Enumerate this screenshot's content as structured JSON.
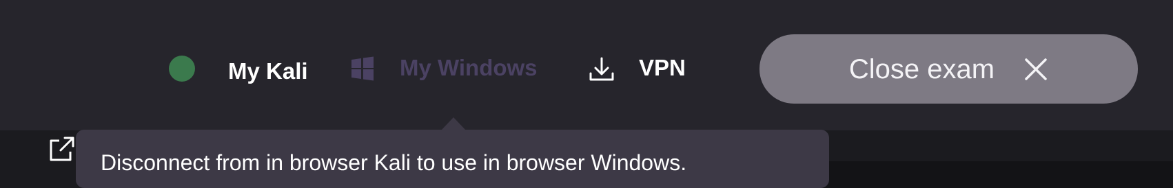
{
  "nav": {
    "kali_label": "My Kali",
    "windows_label": "My Windows",
    "vpn_label": "VPN",
    "kali_status_color": "#3b7a4d",
    "windows_disabled_color": "#4b4263",
    "icons": [
      "status-dot",
      "windows-icon",
      "download-icon"
    ]
  },
  "actions": {
    "close_exam_label": "Close exam",
    "close_icon": "close-icon",
    "button_color": "#7e7a84"
  },
  "tooltip": {
    "text": "Disconnect from in browser Kali to use in browser Windows."
  },
  "toolbar": {
    "icons": [
      "external-link-icon"
    ]
  }
}
